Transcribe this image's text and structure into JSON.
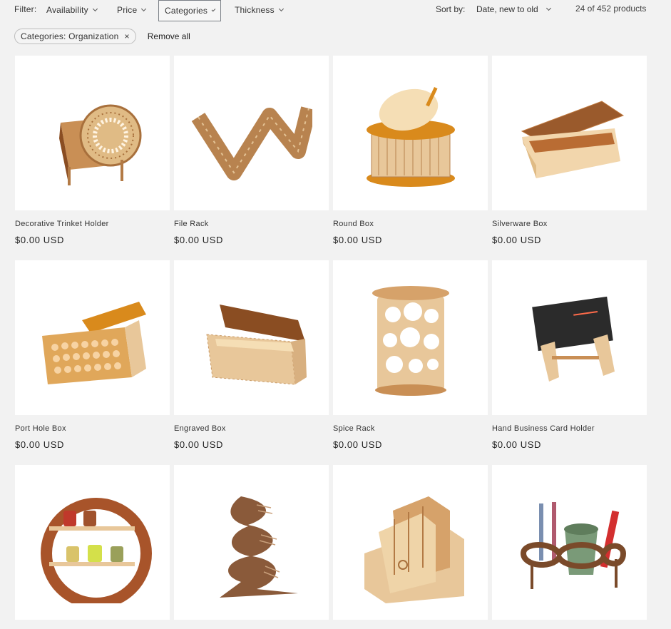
{
  "filters": {
    "label": "Filter:",
    "facets": [
      {
        "label": "Availability"
      },
      {
        "label": "Price"
      },
      {
        "label": "Categories"
      },
      {
        "label": "Thickness"
      }
    ]
  },
  "sort": {
    "label": "Sort by:",
    "selected": "Date, new to old"
  },
  "product_count": "24 of 452 products",
  "active_filters": {
    "chip_label": "Categories: Organization",
    "chip_remove": "×",
    "remove_all": "Remove all"
  },
  "products": [
    {
      "title": "Decorative Trinket Holder",
      "price": "$0.00 USD",
      "icon": "trinket-holder-image"
    },
    {
      "title": "File Rack",
      "price": "$0.00 USD",
      "icon": "file-rack-image"
    },
    {
      "title": "Round Box",
      "price": "$0.00 USD",
      "icon": "round-box-image"
    },
    {
      "title": "Silverware Box",
      "price": "$0.00 USD",
      "icon": "silverware-box-image"
    },
    {
      "title": "Port Hole Box",
      "price": "$0.00 USD",
      "icon": "port-hole-box-image"
    },
    {
      "title": "Engraved Box",
      "price": "$0.00 USD",
      "icon": "engraved-box-image"
    },
    {
      "title": "Spice Rack",
      "price": "$0.00 USD",
      "icon": "spice-rack-image"
    },
    {
      "title": "Hand Business Card Holder",
      "price": "$0.00 USD",
      "icon": "card-holder-image"
    },
    {
      "title": "",
      "price": "",
      "icon": "round-spice-rack-image"
    },
    {
      "title": "",
      "price": "",
      "icon": "wine-rack-image"
    },
    {
      "title": "",
      "price": "",
      "icon": "magazine-file-image"
    },
    {
      "title": "",
      "price": "",
      "icon": "toothbrush-holder-image"
    }
  ],
  "colors": {
    "page_bg": "#f2f2f2",
    "card_bg": "#ffffff",
    "wood_light": "#e8c79a",
    "wood_mid": "#c98f55",
    "wood_dark": "#8a4d22",
    "orange": "#d98a1c"
  }
}
